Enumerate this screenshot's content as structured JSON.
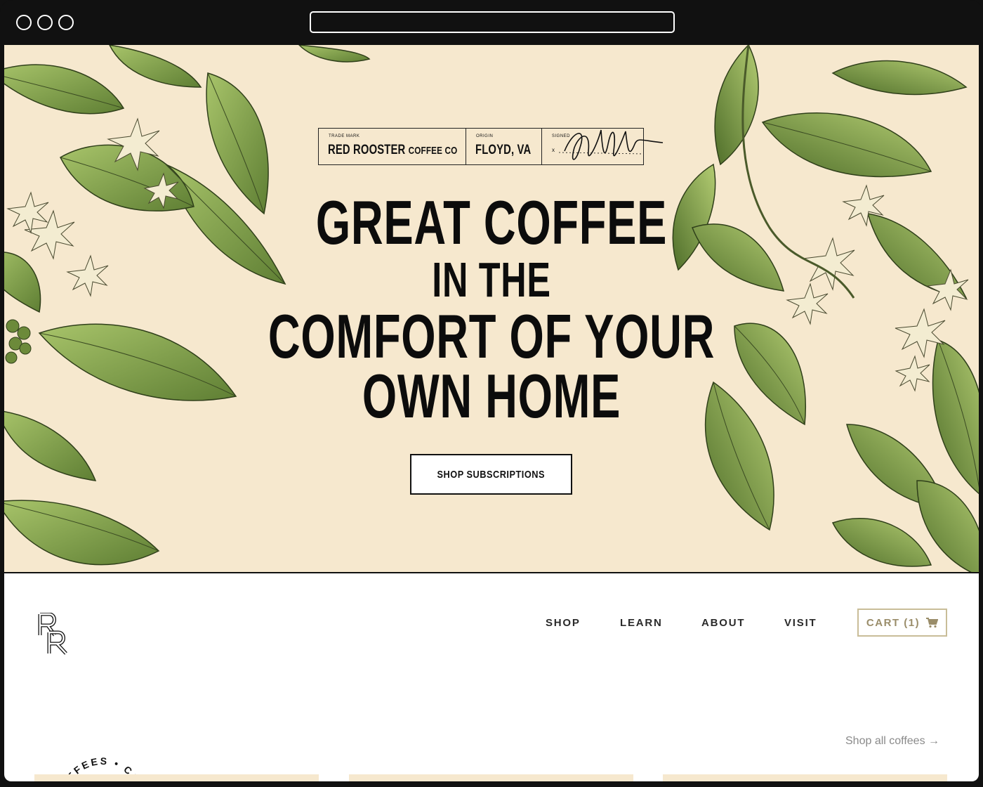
{
  "browser": {
    "window_controls": [
      "close",
      "minimize",
      "maximize"
    ],
    "url": ""
  },
  "hero": {
    "trademark_label": {
      "trade_mark_caption": "TRADE MARK",
      "brand_main": "RED ROOSTER",
      "brand_small": "COFFEE CO",
      "origin_caption": "ORIGIN",
      "origin": "FLOYD, VA",
      "signed_caption": "SIGNED",
      "signed_x": "x"
    },
    "headline": [
      "GREAT COFFEE",
      "IN THE",
      "COMFORT OF YOUR",
      "OWN HOME"
    ],
    "cta_label": "SHOP SUBSCRIPTIONS"
  },
  "header": {
    "nav": [
      "SHOP",
      "LEARN",
      "ABOUT",
      "VISIT"
    ],
    "cart_label": "CART (1)"
  },
  "section": {
    "badge_text": "COFFEES • COFFEES •",
    "shop_all_label": "Shop all coffees →"
  },
  "colors": {
    "hero_bg": "#f6e8ce",
    "cart_border": "#c9bd98",
    "leaf_green": "#7fa04a"
  },
  "icons": [
    "logo-rr-icon",
    "cart-icon",
    "signature-icon",
    "arrow-right-icon"
  ]
}
